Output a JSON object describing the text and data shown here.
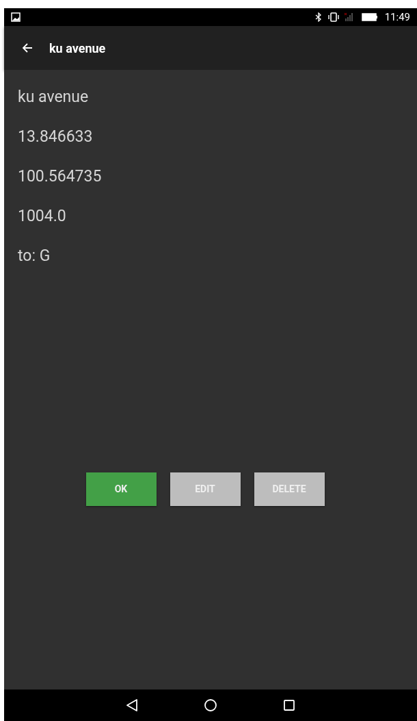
{
  "status_bar": {
    "time": "11:49"
  },
  "app_bar": {
    "title": "ku avenue"
  },
  "details": [
    "ku avenue",
    "13.846633",
    "100.564735",
    "1004.0",
    "to: G"
  ],
  "buttons": [
    {
      "label": "OK",
      "disabled": false
    },
    {
      "label": "EDIT",
      "disabled": true
    },
    {
      "label": "DELETE",
      "disabled": true
    }
  ]
}
